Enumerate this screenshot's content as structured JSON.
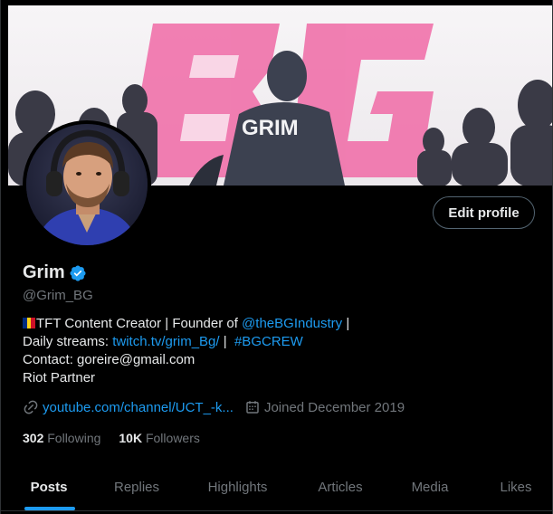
{
  "profile": {
    "display_name": "Grim",
    "handle": "@Grim_BG",
    "edit_label": "Edit profile",
    "verified_icon": "verified-badge-icon",
    "banner_text": "GRIM"
  },
  "bio": {
    "line1_text": "TFT Content Creator | Founder of ",
    "line1_mention": "@theBGIndustry",
    "line1_after": " |",
    "line2_text": "Daily streams: ",
    "line2_link": "twitch.tv/grim_Bg/",
    "line2_mid": " |  ",
    "line2_hashtag": "#BGCREW",
    "line3": "Contact: goreire@gmail.com",
    "line4": "Riot Partner",
    "flag_colors": [
      "#002b7f",
      "#fcd116",
      "#ce1126"
    ]
  },
  "meta": {
    "website": "youtube.com/channel/UCT_-k...",
    "website_icon": "link-icon",
    "joined": "Joined December 2019",
    "joined_icon": "calendar-icon"
  },
  "stats": {
    "following_count": "302",
    "following_label": "Following",
    "followers_count": "10K",
    "followers_label": "Followers"
  },
  "tabs": [
    {
      "label": "Posts",
      "active": true
    },
    {
      "label": "Replies",
      "active": false
    },
    {
      "label": "Highlights",
      "active": false
    },
    {
      "label": "Articles",
      "active": false
    },
    {
      "label": "Media",
      "active": false
    },
    {
      "label": "Likes",
      "active": false
    }
  ],
  "colors": {
    "accent": "#1d9bf0",
    "text_primary": "#e7e9ea",
    "text_secondary": "#71767b",
    "banner_pink": "#f03d8c"
  }
}
